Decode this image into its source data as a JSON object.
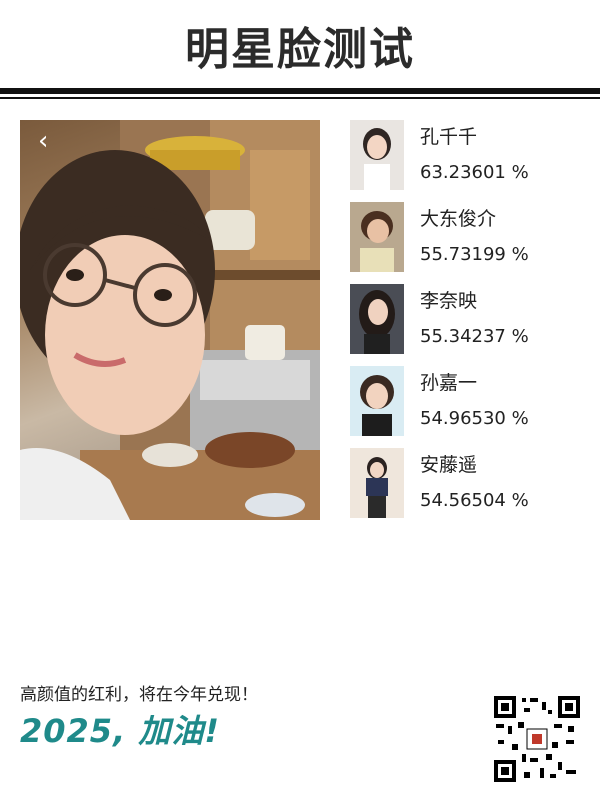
{
  "header": {
    "title": "明星脸测试"
  },
  "main": {
    "back_label": "‹"
  },
  "results": [
    {
      "name": "孔千千",
      "score": "63.23601 %"
    },
    {
      "name": "大东俊介",
      "score": "55.73199 %"
    },
    {
      "name": "李奈映",
      "score": "55.34237 %"
    },
    {
      "name": "孙嘉一",
      "score": "54.96530 %"
    },
    {
      "name": "安藤遥",
      "score": "54.56504 %"
    }
  ],
  "footer": {
    "tagline": "高颜值的红利，将在今年兑现！",
    "slogan": "2025, 加油!"
  },
  "colors": {
    "accent": "#1f8a8a",
    "rule": "#111111"
  }
}
